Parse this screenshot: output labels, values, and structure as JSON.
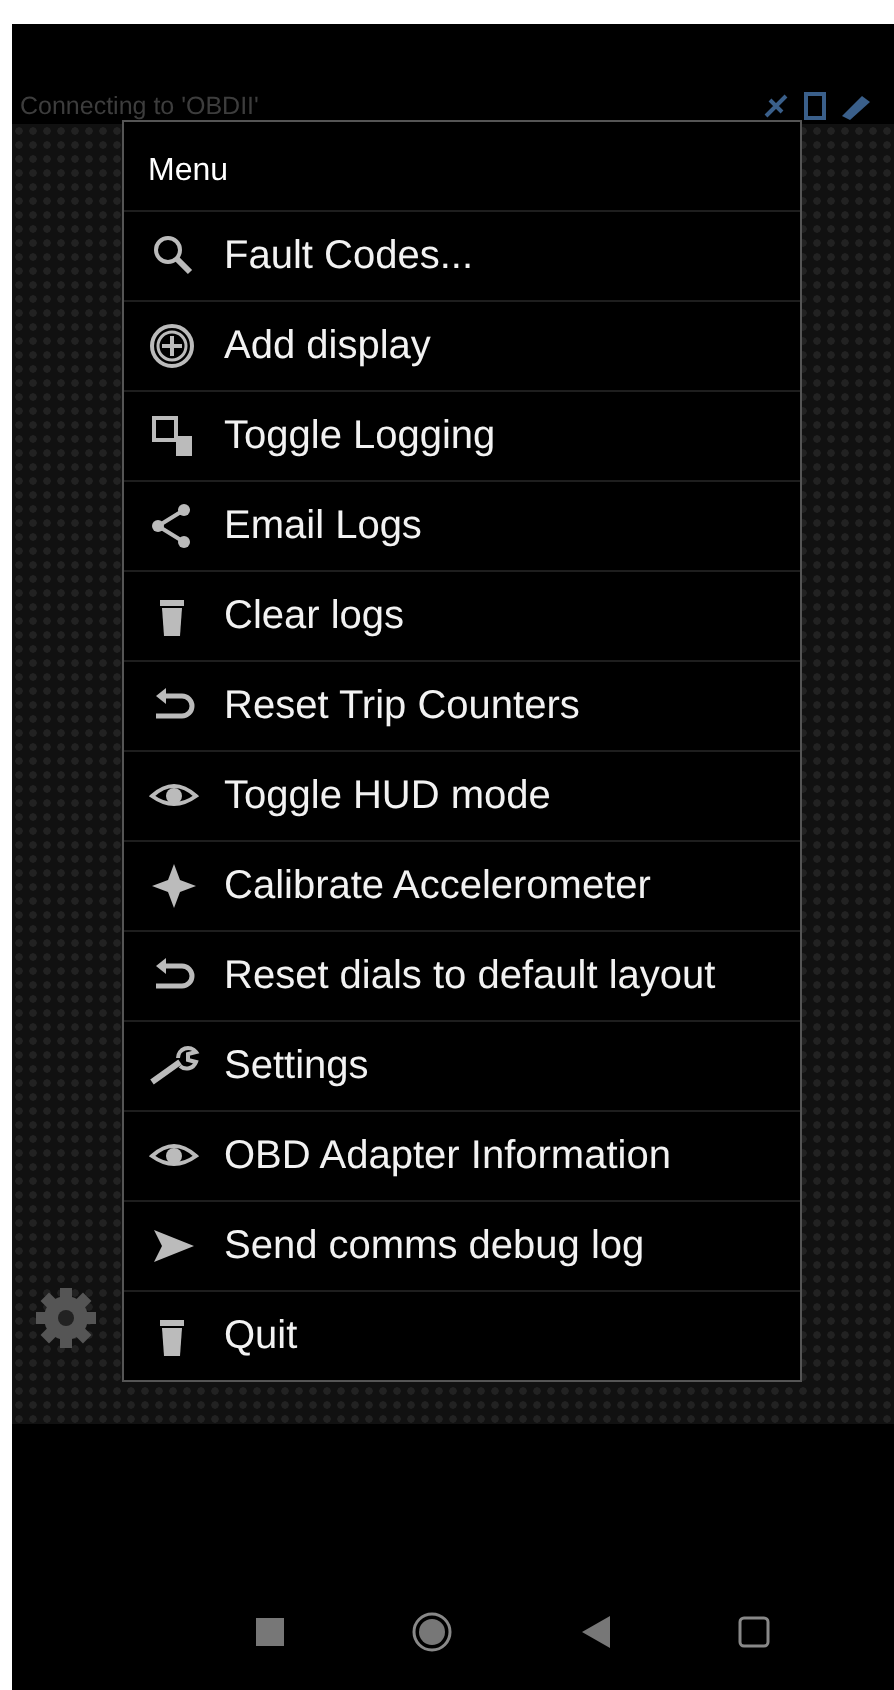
{
  "status": {
    "text": "Connecting to 'OBDII'"
  },
  "menu": {
    "title": "Menu",
    "items": [
      {
        "label": "Fault Codes...",
        "kind": "search"
      },
      {
        "label": "Add display",
        "kind": "add"
      },
      {
        "label": "Toggle Logging",
        "kind": "log"
      },
      {
        "label": "Email Logs",
        "kind": "share"
      },
      {
        "label": "Clear logs",
        "kind": "trash"
      },
      {
        "label": "Reset Trip Counters",
        "kind": "undo"
      },
      {
        "label": "Toggle HUD mode",
        "kind": "eye"
      },
      {
        "label": "Calibrate Accelerometer",
        "kind": "compass"
      },
      {
        "label": "Reset dials to default layout",
        "kind": "undo"
      },
      {
        "label": "Settings",
        "kind": "wrench"
      },
      {
        "label": "OBD Adapter Information",
        "kind": "eye"
      },
      {
        "label": "Send comms debug log",
        "kind": "send"
      },
      {
        "label": "Quit",
        "kind": "trash"
      }
    ]
  }
}
